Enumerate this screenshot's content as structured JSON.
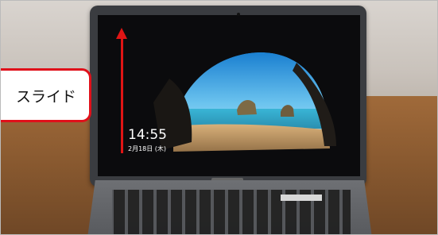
{
  "photo": {
    "description_subject": "laptop-lock-screen"
  },
  "lockscreen": {
    "time": "14:55",
    "date": "2月18日 (木)"
  },
  "callout": {
    "label": "スライド"
  }
}
